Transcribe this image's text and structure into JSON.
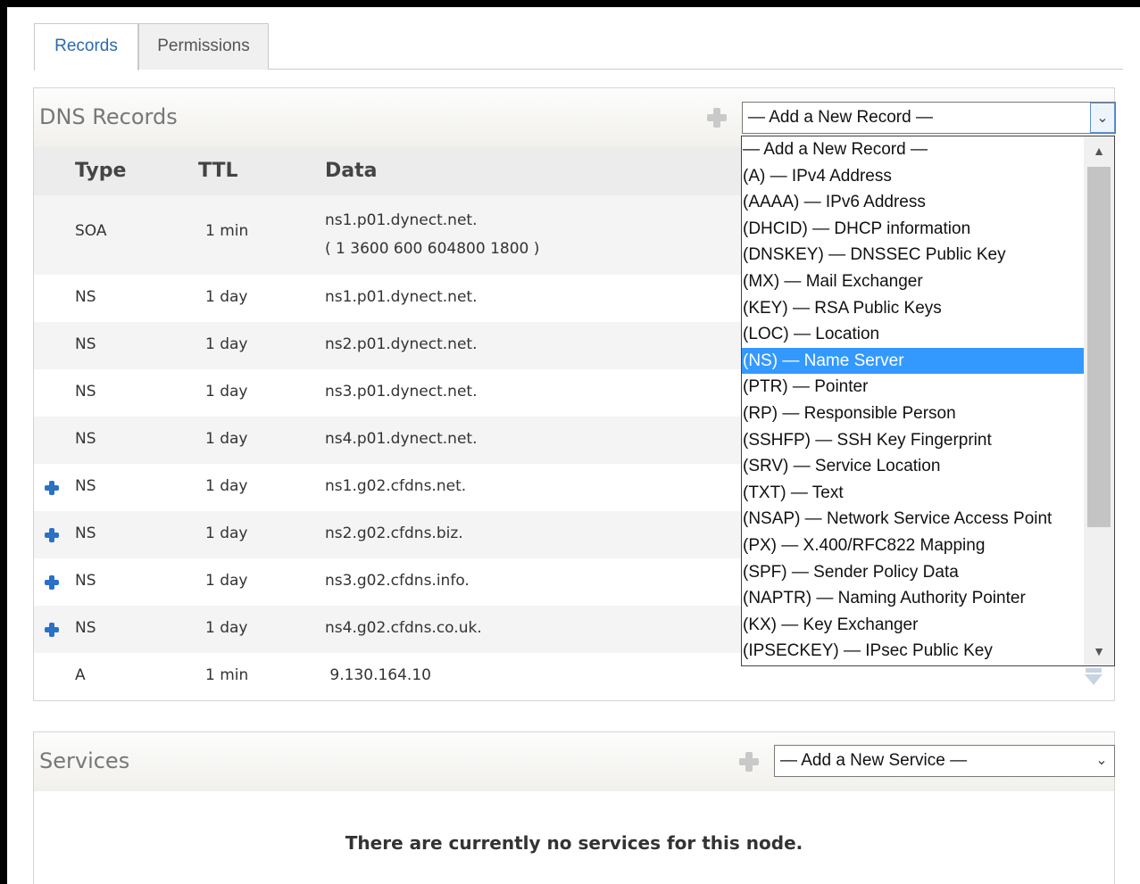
{
  "tabs": [
    {
      "label": "Records",
      "active": true
    },
    {
      "label": "Permissions",
      "active": false
    }
  ],
  "dns": {
    "title": "DNS Records",
    "select_value": "— Add a New Record —",
    "columns": [
      "Type",
      "TTL",
      "Data"
    ],
    "rows": [
      {
        "type": "SOA",
        "ttl": "1 min",
        "data_line1": "ns1.p01.dynect.net.",
        "data_line2": "( 1 3600 600 604800 1800 )",
        "marker": false
      },
      {
        "type": "NS",
        "ttl": "1 day",
        "data": "ns1.p01.dynect.net.",
        "marker": false
      },
      {
        "type": "NS",
        "ttl": "1 day",
        "data": "ns2.p01.dynect.net.",
        "marker": false
      },
      {
        "type": "NS",
        "ttl": "1 day",
        "data": "ns3.p01.dynect.net.",
        "marker": false
      },
      {
        "type": "NS",
        "ttl": "1 day",
        "data": "ns4.p01.dynect.net.",
        "marker": false
      },
      {
        "type": "NS",
        "ttl": "1 day",
        "data": "ns1.g02.cfdns.net.",
        "marker": true
      },
      {
        "type": "NS",
        "ttl": "1 day",
        "data": "ns2.g02.cfdns.biz.",
        "marker": true
      },
      {
        "type": "NS",
        "ttl": "1 day",
        "data": "ns3.g02.cfdns.info.",
        "marker": true
      },
      {
        "type": "NS",
        "ttl": "1 day",
        "data": "ns4.g02.cfdns.co.uk.",
        "marker": true
      },
      {
        "type": "A",
        "ttl": "1 min",
        "data": " 9.130.164.10",
        "marker": false
      }
    ],
    "options": [
      "— Add a New Record —",
      "(A) — IPv4 Address",
      "(AAAA) — IPv6 Address",
      "(DHCID) — DHCP information",
      "(DNSKEY) — DNSSEC Public Key",
      "(MX) — Mail Exchanger",
      "(KEY) — RSA Public Keys",
      "(LOC) — Location",
      "(NS) — Name Server",
      "(PTR) — Pointer",
      "(RP) — Responsible Person",
      "(SSHFP) — SSH Key Fingerprint",
      "(SRV) — Service Location",
      "(TXT) — Text",
      "(NSAP) — Network Service Access Point",
      "(PX) — X.400/RFC822 Mapping",
      "(SPF) — Sender Policy Data",
      "(NAPTR) — Naming Authority Pointer",
      "(KX) — Key Exchanger",
      "(IPSECKEY) — IPsec Public Key"
    ],
    "highlighted_option": "(NS) — Name Server"
  },
  "services": {
    "title": "Services",
    "select_value": "— Add a New Service —",
    "empty_message": "There are currently no services for this node."
  },
  "colors": {
    "accent": "#2a6aad",
    "marker": "#2a70c7",
    "highlight": "#3399ff"
  }
}
